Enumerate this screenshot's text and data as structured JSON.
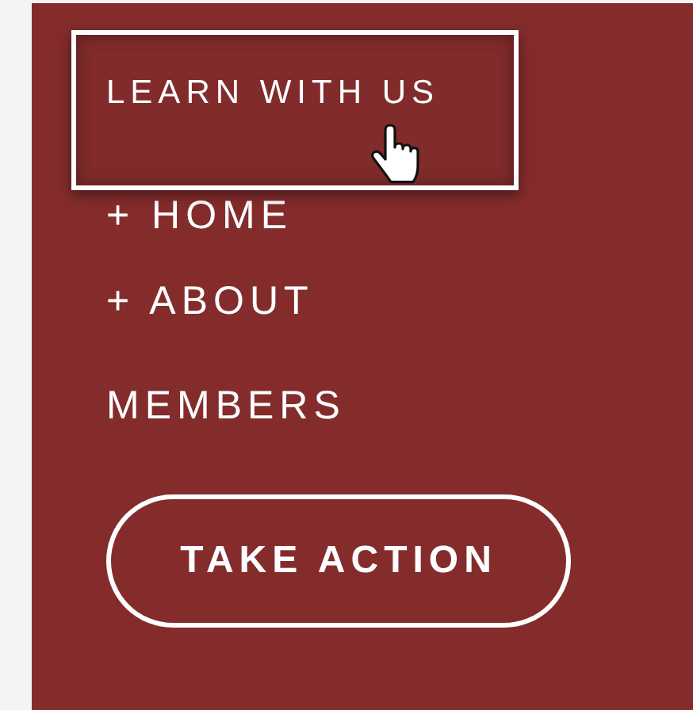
{
  "menu": {
    "items": [
      {
        "kind": "link",
        "label": "LEARN WITH US",
        "hovered": true
      },
      {
        "kind": "link",
        "label": "+ HOME",
        "hovered": false
      },
      {
        "kind": "link",
        "label": "+ ABOUT",
        "hovered": false
      },
      {
        "kind": "link",
        "label": "MEMBERS",
        "hovered": false
      },
      {
        "kind": "button",
        "label": "TAKE ACTION"
      }
    ]
  }
}
